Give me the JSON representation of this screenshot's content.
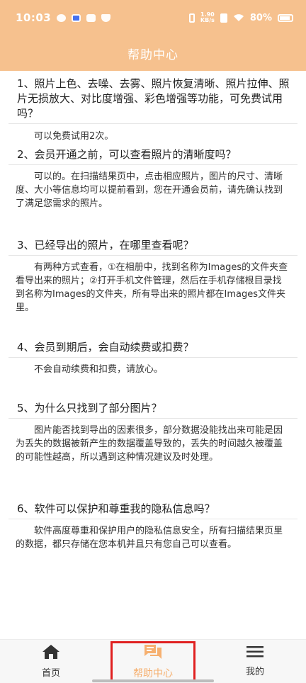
{
  "status_bar": {
    "time": "10:03",
    "speed_value": "1.90",
    "speed_unit": "KB/s",
    "battery": "80%"
  },
  "header": {
    "title": "帮助中心"
  },
  "faq": [
    {
      "question": "1、照片上色、去噪、去雾、照片恢复清晰、照片拉伸、照片无损放大、对比度增强、彩色增强等功能，可免费试用吗？",
      "answer": "可以免费试用2次。"
    },
    {
      "question": "2、会员开通之前，可以查看照片的清晰度吗？",
      "answer": "可以的。在扫描结果页中，点击相应照片，图片的尺寸、清晰度、大小等信息均可以提前看到，您在开通会员前，请先确认找到了满足您需求的照片。"
    },
    {
      "question": "3、已经导出的照片，在哪里查看呢？",
      "answer": "有两种方式查看，①在相册中，找到名称为Images的文件夹查看导出来的照片；②打开手机文件管理，然后在手机存储根目录找到名称为Images的文件夹，所有导出来的照片都在Images文件夹里。"
    },
    {
      "question": "4、会员到期后，会自动续费或扣费？",
      "answer": "不会自动续费和扣费，请放心。"
    },
    {
      "question": "5、为什么只找到了部分图片？",
      "answer": "图片能否找到导出的因素很多，部分数据没能找出来可能是因为丢失的数据被新产生的数据覆盖导致的，丢失的时间越久被覆盖的可能性越高，所以遇到这种情况建议及时处理。"
    },
    {
      "question": "6、软件可以保护和尊重我的隐私信息吗？",
      "answer": "软件高度尊重和保护用户的隐私信息安全，所有扫描结果页里的数据，都只存储在您本机并且只有您自己可以查看。"
    }
  ],
  "bottom_nav": {
    "home_label": "首页",
    "help_label": "帮助中心",
    "mine_label": "我的"
  },
  "colors": {
    "header": "#f6c18e",
    "active_tab": "#f6b070",
    "highlight": "#e02020"
  }
}
